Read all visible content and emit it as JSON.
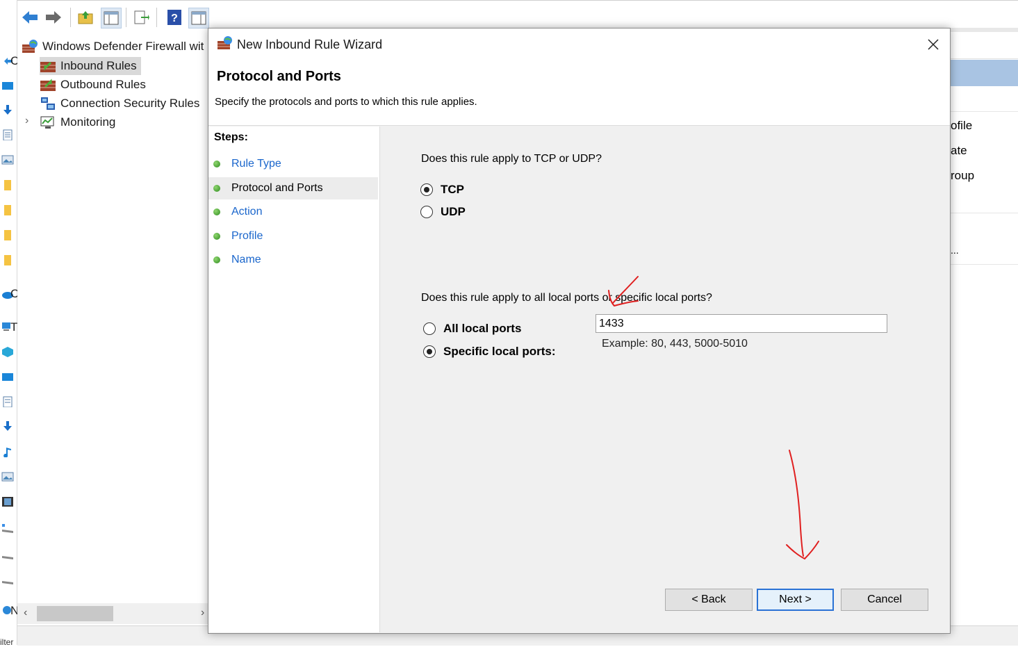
{
  "toolbar": {
    "icons": [
      "back-arrow-icon",
      "forward-arrow-icon",
      "up-folder-icon",
      "show-hide-tree-icon",
      "export-list-icon",
      "help-icon",
      "show-hide-action-pane-icon"
    ]
  },
  "left_strip": {
    "chars": [
      "C",
      "C",
      "T",
      "N"
    ],
    "bottom_text": "ilter"
  },
  "tree": {
    "root": "Windows Defender Firewall wit",
    "items": [
      {
        "label": "Inbound Rules",
        "selected": true
      },
      {
        "label": "Outbound Rules",
        "selected": false
      },
      {
        "label": "Connection Security Rules",
        "selected": false
      },
      {
        "label": "Monitoring",
        "selected": false,
        "expander": "›"
      }
    ],
    "scroll_left": "‹",
    "scroll_right": "›"
  },
  "right_pane": {
    "items": [
      "ofile",
      "ate",
      "roup",
      "..."
    ]
  },
  "dialog": {
    "title": "New Inbound Rule Wizard",
    "heading": "Protocol and Ports",
    "subheading": "Specify the protocols and ports to which this rule applies.",
    "steps_title": "Steps:",
    "steps": [
      {
        "label": "Rule Type",
        "current": false
      },
      {
        "label": "Protocol and Ports",
        "current": true
      },
      {
        "label": "Action",
        "current": false
      },
      {
        "label": "Profile",
        "current": false
      },
      {
        "label": "Name",
        "current": false
      }
    ],
    "protocol_question": "Does this rule apply to TCP or UDP?",
    "protocol_options": [
      {
        "label": "TCP",
        "selected": true
      },
      {
        "label": "UDP",
        "selected": false
      }
    ],
    "ports_question": "Does this rule apply to all local ports or specific local ports?",
    "port_options": [
      {
        "label": "All local ports",
        "selected": false
      },
      {
        "label": "Specific local ports:",
        "selected": true
      }
    ],
    "ports_value": "1433",
    "ports_example": "Example: 80, 443, 5000-5010",
    "buttons": {
      "back": "< Back",
      "next": "Next >",
      "cancel": "Cancel"
    }
  },
  "colors": {
    "link": "#1a66cc",
    "annotation": "#e02020",
    "default_button_border": "#2a72d5"
  }
}
